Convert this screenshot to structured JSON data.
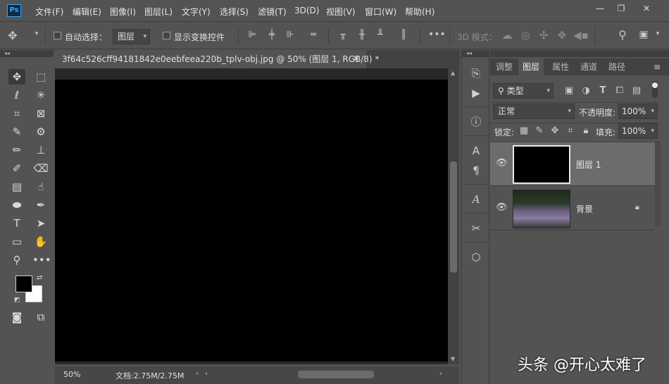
{
  "app": {
    "logo": "Ps"
  },
  "menu": [
    "文件(F)",
    "编辑(E)",
    "图像(I)",
    "图层(L)",
    "文字(Y)",
    "选择(S)",
    "滤镜(T)",
    "3D(D)",
    "视图(V)",
    "窗口(W)",
    "帮助(H)"
  ],
  "window_controls": {
    "minimize": "—",
    "restore": "❐",
    "close": "✕"
  },
  "options": {
    "auto_select_label": "自动选择：",
    "auto_select_value": "图层",
    "show_transform_label": "显示变换控件",
    "mode_3d_label": "3D 模式："
  },
  "document": {
    "tab_title": "3f64c526cff94181842e0eebfeea220b_tplv-obj.jpg @ 50% (图层 1, RGB/8) *",
    "close": "×",
    "zoom": "50%",
    "doc_info": "文档:2.75M/2.75M"
  },
  "panel": {
    "tabs": [
      "调整",
      "图层",
      "属性",
      "通道",
      "路径"
    ],
    "active_tab": "图层",
    "filter_kind": "类型",
    "blend_mode": "正常",
    "opacity_label": "不透明度:",
    "opacity_value": "100%",
    "lock_label": "锁定:",
    "fill_label": "填充:",
    "fill_value": "100%",
    "layers": [
      {
        "name": "图层 1",
        "selected": true
      },
      {
        "name": "背景",
        "locked": true
      }
    ]
  },
  "watermark": "头条 @开心太难了",
  "colors": {
    "foreground": "#000000",
    "background": "#ffffff",
    "accent": "#31a8ff"
  }
}
